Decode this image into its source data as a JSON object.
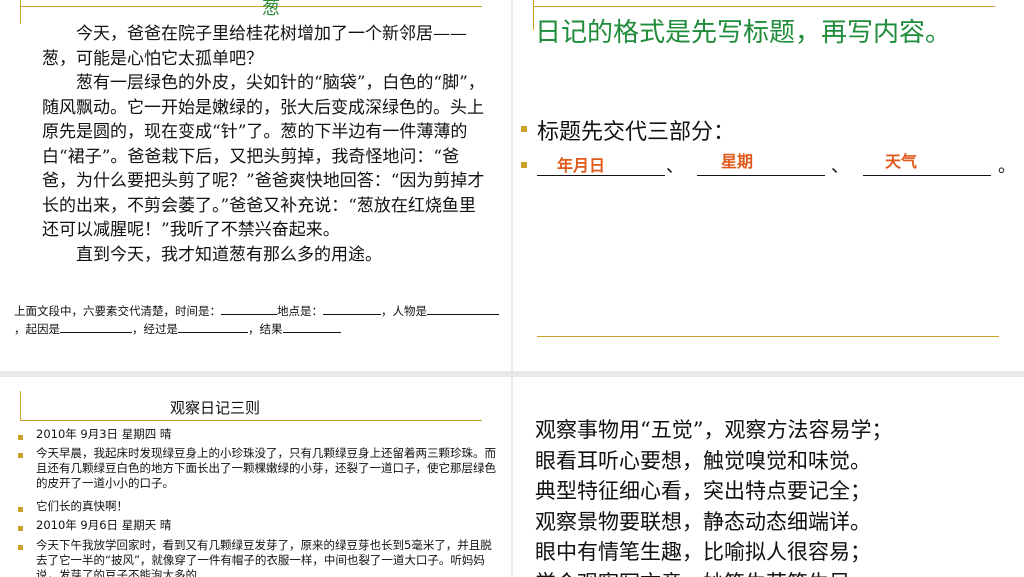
{
  "slide1": {
    "title": "葱",
    "story": [
      {
        "indent": true,
        "text": "今天，爸爸在院子里给桂花树增加了一个新邻居——葱，可能是心怕它太孤单吧？"
      },
      {
        "indent": true,
        "text": "葱有一层绿色的外皮，尖如针的“脑袋”，白色的“脚”，随风飘动。它一开始是嫩绿的，张大后变成深绿色的。头上原先是圆的，现在变成“针”了。葱的下半边有一件薄薄的白“裙子”。爸爸栽下后，又把头剪掉，我奇怪地问：“爸爸，为什么要把头剪了呢？”爸爸爽快地回答：“因为剪掉才长的出来，不剪会萎了。”爸爸又补充说：“葱放在红烧鱼里还可以减腥呢！”我听了不禁兴奋起来。"
      },
      {
        "indent": true,
        "text": "直到今天，我才知道葱有那么多的用途。"
      }
    ],
    "question": {
      "p1": "上面文段中，六要素交代清楚，时间是：",
      "p2": "地点是：",
      "p3": "，人物是",
      "p4": "，起因是",
      "p5": "，经过是",
      "p6": "，结果"
    }
  },
  "slide2": {
    "heading": "日记的格式是先写标题，再写内容。",
    "bullet1": "标题先交代三部分：",
    "answers": [
      "年月日",
      "星期",
      "天气"
    ],
    "sep1": "、",
    "sep2": "、",
    "end": "。"
  },
  "slide3": {
    "title": "观察日记三则",
    "items": [
      "2010年 9月3日        星期四        晴",
      "今天早晨，我起床时发现绿豆身上的小珍珠没了，只有几颗绿豆身上还留着两三颗珍珠。而且还有几颗绿豆白色的地方下面长出了一颗棵嫩绿的小芽，还裂了一道口子，使它那层绿色的皮开了一道小小的口子。",
      "它们长的真快啊！",
      "2010年 9月6日        星期天        晴",
      "今天下午我放学回家时，看到又有几颗绿豆发芽了，原来的绿豆芽也长到5毫米了，并且脱去了它一半的“披风”，就像穿了一件有帽子的衣服一样，中间也裂了一道大口子。听妈妈说，发芽了的豆子不能泡太多的"
    ]
  },
  "slide4": {
    "lines": [
      "观察事物用“五觉”，观察方法容易学；",
      "眼看耳听心要想，触觉嗅觉和味觉。",
      "典型特征细心看，突出特点要记全；",
      "观察景物要联想，静态动态细端详。",
      "眼中有情笔生趣，比喻拟人很容易；",
      "学会观察写文章，妙笔生花笔生另"
    ]
  },
  "colors": {
    "accent_gold": "#c9a227",
    "heading_green": "#1f8c3a",
    "answer_orange": "#e05a1a"
  }
}
